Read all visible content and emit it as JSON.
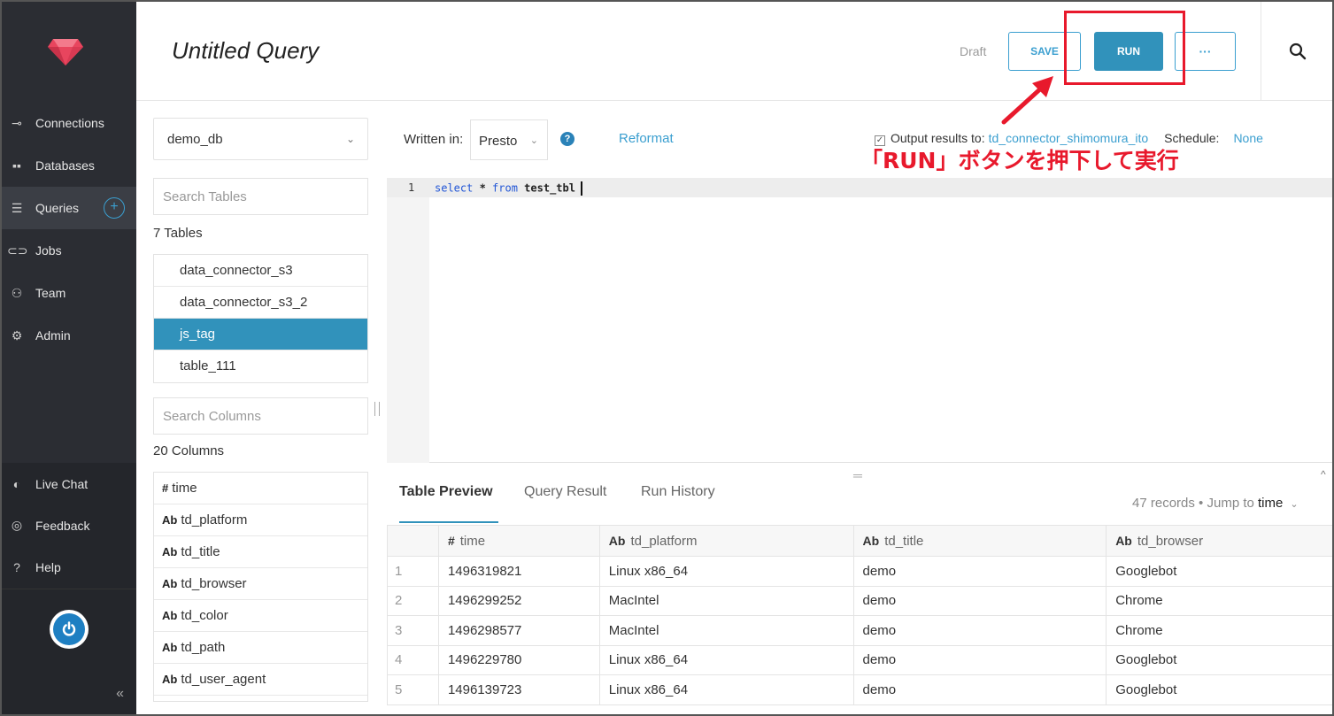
{
  "sidebar": {
    "items": [
      {
        "label": "Connections",
        "icon": "plug-icon"
      },
      {
        "label": "Databases",
        "icon": "database-icon"
      },
      {
        "label": "Queries",
        "icon": "queries-icon"
      },
      {
        "label": "Jobs",
        "icon": "jobs-icon"
      },
      {
        "label": "Team",
        "icon": "team-icon"
      },
      {
        "label": "Admin",
        "icon": "gear-icon"
      }
    ],
    "add_query_symbol": "+",
    "bottom_items": [
      {
        "label": "Live Chat",
        "icon": "chat-icon"
      },
      {
        "label": "Feedback",
        "icon": "feedback-icon"
      },
      {
        "label": "Help",
        "icon": "help-icon"
      }
    ],
    "collapse_symbol": "«"
  },
  "header": {
    "title": "Untitled Query",
    "status": "Draft",
    "save_label": "SAVE",
    "run_label": "RUN",
    "more_label": "···"
  },
  "left_panel": {
    "database": "demo_db",
    "search_tables_placeholder": "Search Tables",
    "tables_count": "7 Tables",
    "tables": [
      "data_connector_s3",
      "data_connector_s3_2",
      "js_tag",
      "table_111"
    ],
    "selected_table": "js_tag",
    "search_columns_placeholder": "Search Columns",
    "columns_count": "20 Columns",
    "columns": [
      {
        "type": "#",
        "name": "time"
      },
      {
        "type": "Ab",
        "name": "td_platform"
      },
      {
        "type": "Ab",
        "name": "td_title"
      },
      {
        "type": "Ab",
        "name": "td_browser"
      },
      {
        "type": "Ab",
        "name": "td_color"
      },
      {
        "type": "Ab",
        "name": "td_path"
      },
      {
        "type": "Ab",
        "name": "td_user_agent"
      }
    ]
  },
  "editor": {
    "written_in_label": "Written in:",
    "engine": "Presto",
    "help_symbol": "?",
    "reformat_label": "Reformat",
    "output_label": "Output results to:",
    "output_target": "td_connector_shimomura_ito",
    "schedule_label": "Schedule:",
    "schedule_value": "None",
    "line_number": "1",
    "code": {
      "kw1": "select",
      "mid": " * ",
      "kw2": "from",
      "rest": " test_tbl"
    }
  },
  "results": {
    "tabs": [
      "Table Preview",
      "Query Result",
      "Run History"
    ],
    "records": "47 records",
    "separator": "•",
    "jump_to_label": "Jump to",
    "jump_to_value": "time",
    "columns": [
      {
        "type": "#",
        "name": "time"
      },
      {
        "type": "Ab",
        "name": "td_platform"
      },
      {
        "type": "Ab",
        "name": "td_title"
      },
      {
        "type": "Ab",
        "name": "td_browser"
      }
    ],
    "rows": [
      [
        "1",
        "1496319821",
        "Linux x86_64",
        "demo",
        "Googlebot"
      ],
      [
        "2",
        "1496299252",
        "MacIntel",
        "demo",
        "Chrome"
      ],
      [
        "3",
        "1496298577",
        "MacIntel",
        "demo",
        "Chrome"
      ],
      [
        "4",
        "1496229780",
        "Linux x86_64",
        "demo",
        "Googlebot"
      ],
      [
        "5",
        "1496139723",
        "Linux x86_64",
        "demo",
        "Googlebot"
      ]
    ]
  },
  "annotation": {
    "text": "「RUN」ボタンを押下して実行",
    "color": "#e8192c"
  },
  "colors": {
    "accent": "#3192bb",
    "sidebar_bg": "#2b2d33"
  }
}
